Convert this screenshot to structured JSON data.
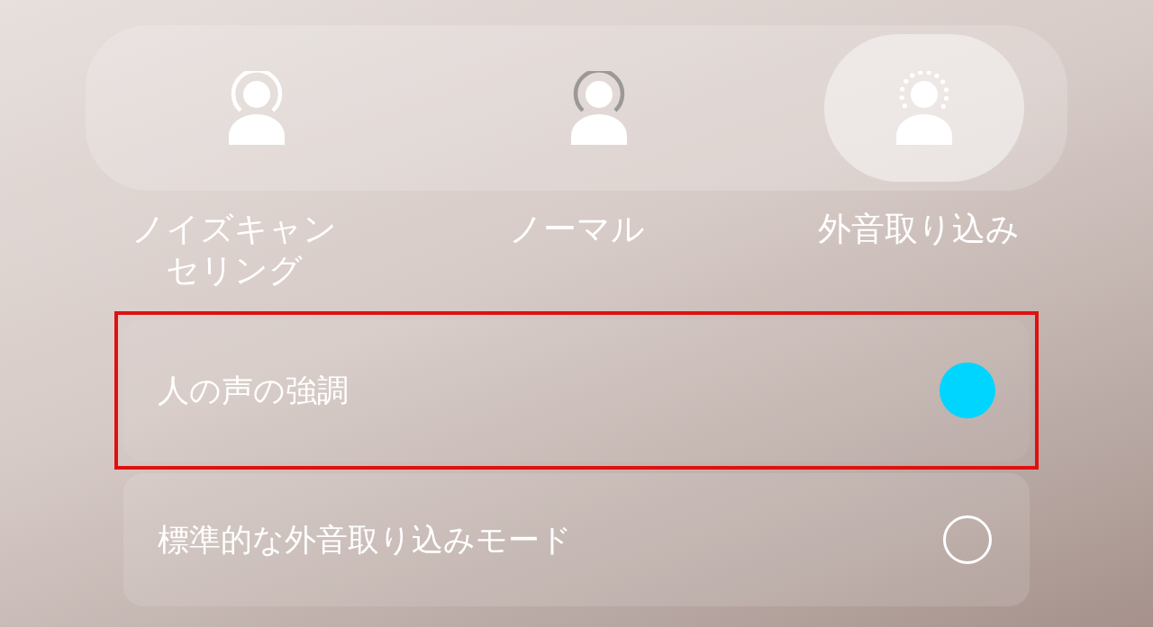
{
  "modes": [
    {
      "kind": "noise_cancelling",
      "label": "ノイズキャンセリング",
      "selected": false
    },
    {
      "kind": "normal",
      "label": "ノーマル",
      "selected": false
    },
    {
      "kind": "ambient",
      "label": "外音取り込み",
      "selected": true
    }
  ],
  "options": [
    {
      "label": "人の声の強調",
      "selected": true,
      "highlighted": true
    },
    {
      "label": "標準的な外音取り込みモード",
      "selected": false,
      "highlighted": false
    }
  ]
}
